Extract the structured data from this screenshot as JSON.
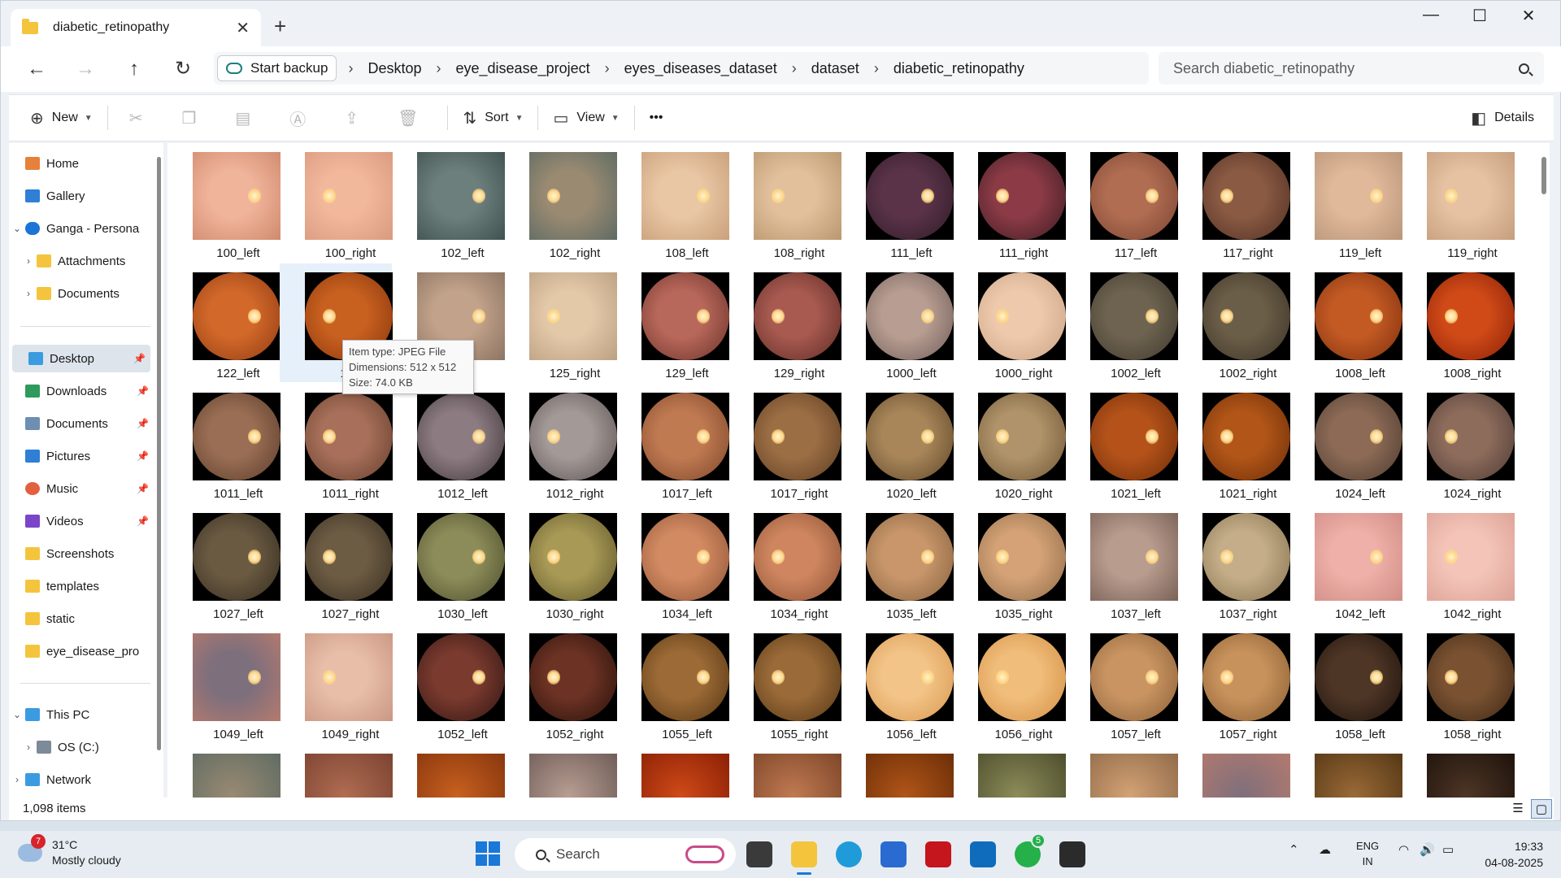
{
  "window": {
    "tab_title": "diabetic_retinopathy",
    "controls": [
      "—",
      "☐",
      "✕"
    ]
  },
  "address": {
    "backup_label": "Start backup",
    "breadcrumbs": [
      "Desktop",
      "eye_disease_project",
      "eyes_diseases_dataset",
      "dataset",
      "diabetic_retinopathy"
    ],
    "search_placeholder": "Search diabetic_retinopathy"
  },
  "commandbar": {
    "new_label": "New",
    "sort_label": "Sort",
    "view_label": "View",
    "more_label": "•••",
    "details_label": "Details"
  },
  "sidebar": {
    "items": [
      {
        "label": "Home",
        "icon": "home-icon",
        "color": "#e7803a"
      },
      {
        "label": "Gallery",
        "icon": "gallery-icon",
        "color": "#2f7fd6"
      },
      {
        "label": "Ganga - Persona",
        "icon": "onedrive-icon",
        "color": "#1c73d8"
      },
      {
        "label": "Attachments",
        "icon": "folder-icon",
        "color": "#f4c43c"
      },
      {
        "label": "Documents",
        "icon": "folder-icon",
        "color": "#f4c43c"
      },
      {
        "label": "Desktop",
        "icon": "desktop-icon",
        "color": "#3b9be0"
      },
      {
        "label": "Downloads",
        "icon": "download-icon",
        "color": "#2f9a5b"
      },
      {
        "label": "Documents",
        "icon": "documents-icon",
        "color": "#6f8fb2"
      },
      {
        "label": "Pictures",
        "icon": "pictures-icon",
        "color": "#2f7fd6"
      },
      {
        "label": "Music",
        "icon": "music-icon",
        "color": "#e2603f"
      },
      {
        "label": "Videos",
        "icon": "videos-icon",
        "color": "#7a45c7"
      },
      {
        "label": "Screenshots",
        "icon": "folder-icon",
        "color": "#f4c43c"
      },
      {
        "label": "templates",
        "icon": "folder-icon",
        "color": "#f4c43c"
      },
      {
        "label": "static",
        "icon": "folder-icon",
        "color": "#f4c43c"
      },
      {
        "label": "eye_disease_pro",
        "icon": "folder-icon",
        "color": "#f4c43c"
      },
      {
        "label": "This PC",
        "icon": "pc-icon",
        "color": "#3b9be0"
      },
      {
        "label": "OS (C:)",
        "icon": "drive-icon",
        "color": "#7c8a99"
      },
      {
        "label": "Network",
        "icon": "network-icon",
        "color": "#3b9be0"
      }
    ]
  },
  "files": [
    "100_left",
    "100_right",
    "102_left",
    "102_right",
    "108_left",
    "108_right",
    "111_left",
    "111_right",
    "117_left",
    "117_right",
    "119_left",
    "119_right",
    "122_left",
    "122_right",
    "125_left",
    "125_right",
    "129_left",
    "129_right",
    "1000_left",
    "1000_right",
    "1002_left",
    "1002_right",
    "1008_left",
    "1008_right",
    "1011_left",
    "1011_right",
    "1012_left",
    "1012_right",
    "1017_left",
    "1017_right",
    "1020_left",
    "1020_right",
    "1021_left",
    "1021_right",
    "1024_left",
    "1024_right",
    "1027_left",
    "1027_right",
    "1030_left",
    "1030_right",
    "1034_left",
    "1034_right",
    "1035_left",
    "1035_right",
    "1037_left",
    "1037_right",
    "1042_left",
    "1042_right",
    "1049_left",
    "1049_right",
    "1052_left",
    "1052_right",
    "1055_left",
    "1055_right",
    "1056_left",
    "1056_right",
    "1057_left",
    "1057_right",
    "1058_left",
    "1058_right"
  ],
  "row2_label_122_right": "122",
  "row2_label_125_left": "ft",
  "tooltip": {
    "type": "Item type: JPEG File",
    "dimensions": "Dimensions: 512 x 512",
    "size": "Size: 74.0 KB"
  },
  "status": {
    "item_count": "1,098 items"
  },
  "taskbar": {
    "weather_temp": "31°C",
    "weather_desc": "Mostly cloudy",
    "weather_badge": "7",
    "search_label": "Search",
    "whatsapp_badge": "5",
    "lang_top": "ENG",
    "lang_bottom": "IN",
    "time": "19:33",
    "date": "04-08-2025"
  },
  "colors": {
    "accent": "#1a78d8",
    "folder": "#f4c43c"
  }
}
